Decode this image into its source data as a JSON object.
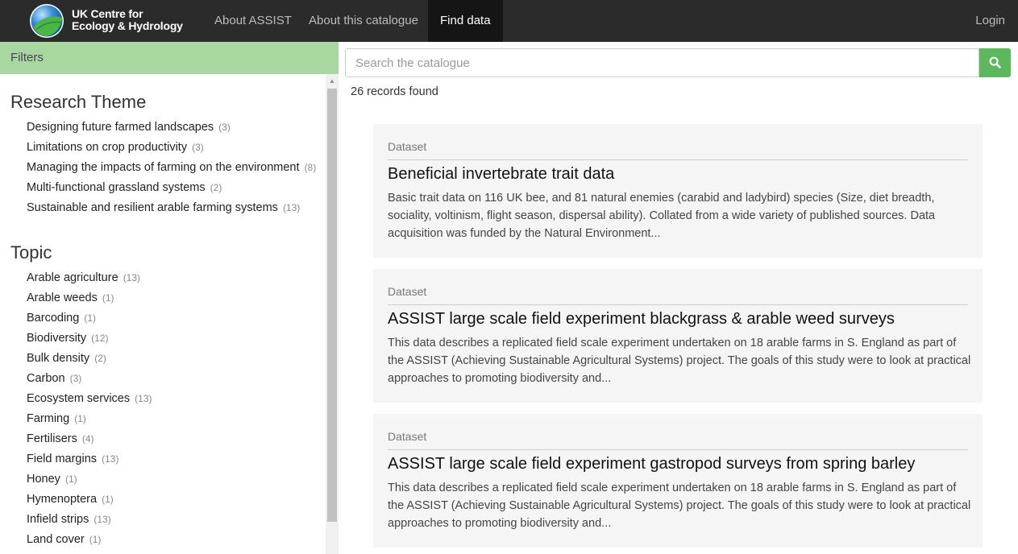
{
  "brand": {
    "line1": "UK Centre for",
    "line2": "Ecology & Hydrology"
  },
  "nav": {
    "items": [
      "About ASSIST",
      "About this catalogue",
      "Find data"
    ],
    "active": "Find data",
    "login": "Login"
  },
  "filters": {
    "header": "Filters",
    "research_theme": {
      "title": "Research Theme",
      "items": [
        {
          "label": "Designing future farmed landscapes",
          "count": "(3)"
        },
        {
          "label": "Limitations on crop productivity",
          "count": "(3)"
        },
        {
          "label": "Managing the impacts of farming on the environment",
          "count": "(8)"
        },
        {
          "label": "Multi-functional grassland systems",
          "count": "(2)"
        },
        {
          "label": "Sustainable and resilient arable farming systems",
          "count": "(13)"
        }
      ]
    },
    "topic": {
      "title": "Topic",
      "items": [
        {
          "label": "Arable agriculture",
          "count": "(13)"
        },
        {
          "label": "Arable weeds",
          "count": "(1)"
        },
        {
          "label": "Barcoding",
          "count": "(1)"
        },
        {
          "label": "Biodiversity",
          "count": "(12)"
        },
        {
          "label": "Bulk density",
          "count": "(2)"
        },
        {
          "label": "Carbon",
          "count": "(3)"
        },
        {
          "label": "Ecosystem services",
          "count": "(13)"
        },
        {
          "label": "Farming",
          "count": "(1)"
        },
        {
          "label": "Fertilisers",
          "count": "(4)"
        },
        {
          "label": "Field margins",
          "count": "(13)"
        },
        {
          "label": "Honey",
          "count": "(1)"
        },
        {
          "label": "Hymenoptera",
          "count": "(1)"
        },
        {
          "label": "Infield strips",
          "count": "(13)"
        },
        {
          "label": "Land cover",
          "count": "(1)"
        }
      ]
    }
  },
  "search": {
    "placeholder": "Search the catalogue",
    "value": ""
  },
  "results": {
    "count_text": "26 records found",
    "cards": [
      {
        "type": "Dataset",
        "title": "Beneficial invertebrate trait data",
        "description": "Basic trait data on 116 UK bee, and 81 natural enemies (carabid and ladybird) species (Size, diet breadth, sociality, voltinism, flight season, dispersal ability). Collated from a wide variety of published sources. Data acquisition was funded by the Natural Environment..."
      },
      {
        "type": "Dataset",
        "title": "ASSIST large scale field experiment blackgrass & arable weed surveys",
        "description": "This data describes a replicated field scale experiment undertaken on 18 arable farms in S. England as part of the ASSIST (Achieving Sustainable Agricultural Systems) project. The goals of this study were to look at practical approaches to promoting biodiversity and..."
      },
      {
        "type": "Dataset",
        "title": "ASSIST large scale field experiment gastropod surveys from spring barley",
        "description": "This data describes a replicated field scale experiment undertaken on 18 arable farms in S. England as part of the ASSIST (Achieving Sustainable Agricultural Systems) project. The goals of this study were to look at practical approaches to promoting biodiversity and..."
      }
    ]
  },
  "colors": {
    "nav_bg": "#2b2b2b",
    "filters_header": "#a8d8a0",
    "search_button": "#5cb85c",
    "card_bg": "#f5f5f5"
  },
  "icons": {
    "logo": "ukceh-globe-logo",
    "search": "magnifier-icon"
  }
}
